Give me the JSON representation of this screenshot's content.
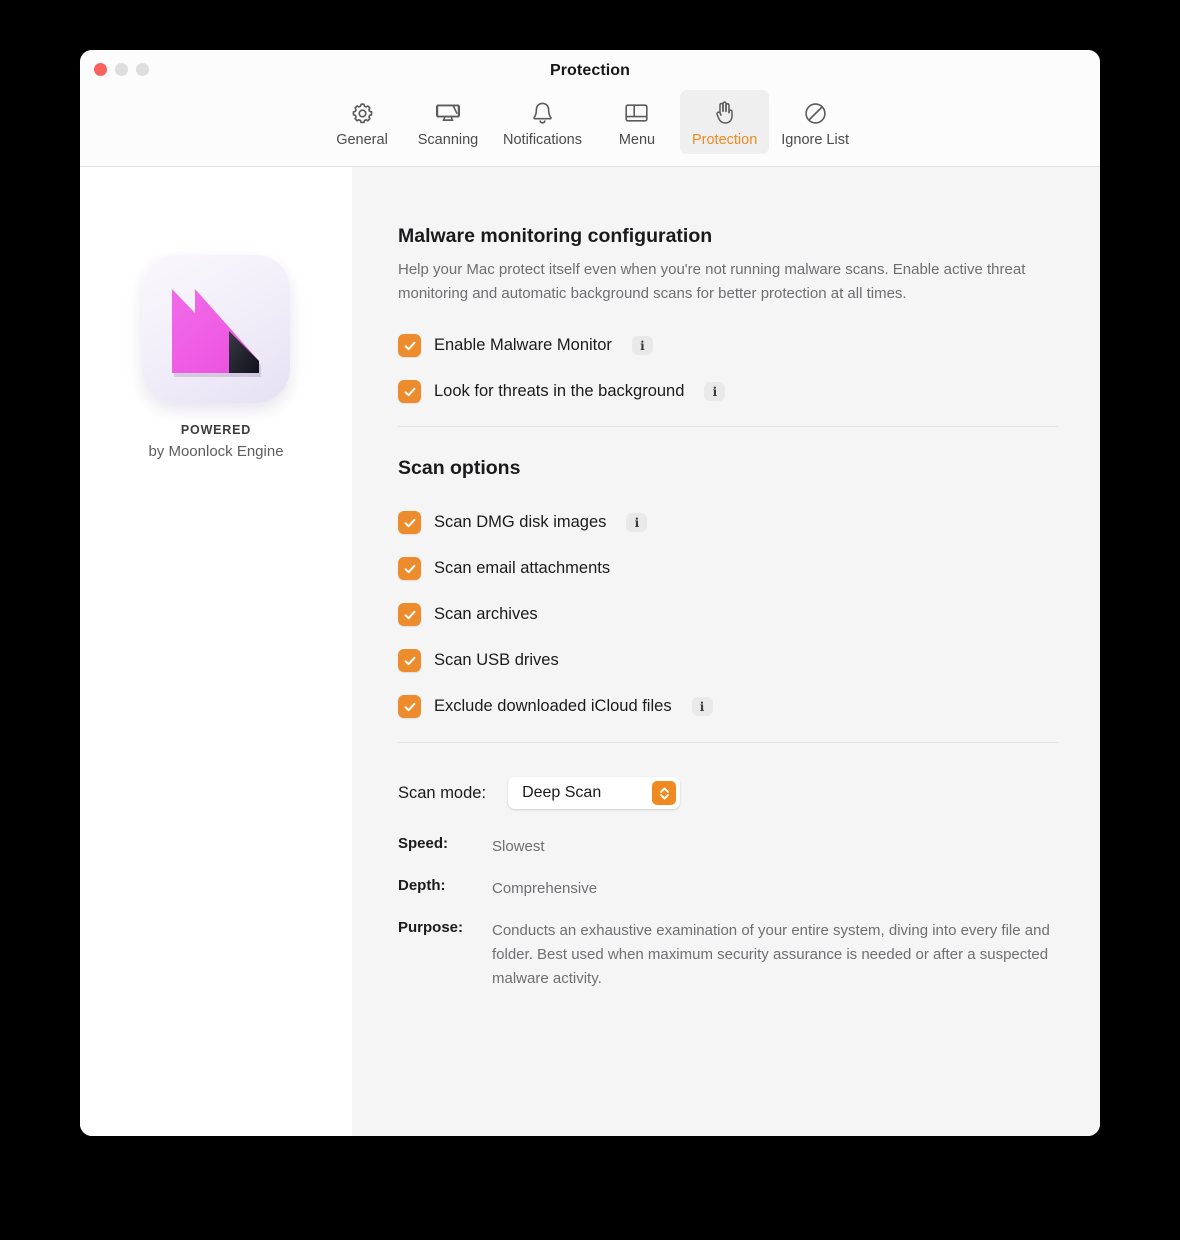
{
  "window": {
    "title": "Protection",
    "traffic_lights": [
      "close-button",
      "minimize-button",
      "zoom-button"
    ]
  },
  "toolbar": {
    "tabs": [
      {
        "label": "General",
        "icon": "gear-icon",
        "selected": false
      },
      {
        "label": "Scanning",
        "icon": "monitor-scan-icon",
        "selected": false
      },
      {
        "label": "Notifications",
        "icon": "bell-icon",
        "selected": false
      },
      {
        "label": "Menu",
        "icon": "sidebar-layout-icon",
        "selected": false
      },
      {
        "label": "Protection",
        "icon": "hand-icon",
        "selected": true
      },
      {
        "label": "Ignore List",
        "icon": "no-entry-icon",
        "selected": false
      }
    ],
    "selected_color": "#ef8a21",
    "selected_bg": "#efefef"
  },
  "sidebar": {
    "logo_icon": "moonlock-logo-icon",
    "powered_label": "POWERED",
    "engine_label": "by Moonlock Engine"
  },
  "main": {
    "monitoring": {
      "title": "Malware monitoring configuration",
      "description": "Help your Mac protect itself even when you're not running malware scans. Enable active threat monitoring and automatic background scans for better protection at all times.",
      "options": [
        {
          "label": "Enable Malware Monitor",
          "checked": true,
          "info": true,
          "info_glyph": "i"
        },
        {
          "label": "Look for threats in the background",
          "checked": true,
          "info": true,
          "info_glyph": "i"
        }
      ]
    },
    "scan_options": {
      "title": "Scan options",
      "options": [
        {
          "label": "Scan DMG disk images",
          "checked": true,
          "info": true,
          "info_glyph": "i"
        },
        {
          "label": "Scan email attachments",
          "checked": true,
          "info": false,
          "info_glyph": "i"
        },
        {
          "label": "Scan archives",
          "checked": true,
          "info": false,
          "info_glyph": "i"
        },
        {
          "label": "Scan USB drives",
          "checked": true,
          "info": false,
          "info_glyph": "i"
        },
        {
          "label": "Exclude downloaded iCloud files",
          "checked": true,
          "info": true,
          "info_glyph": "i"
        }
      ]
    },
    "scan_mode": {
      "label": "Scan mode:",
      "selected": "Deep Scan",
      "details": [
        {
          "key": "Speed:",
          "value": "Slowest"
        },
        {
          "key": "Depth:",
          "value": "Comprehensive"
        },
        {
          "key": "Purpose:",
          "value": "Conducts an exhaustive examination of your entire system, diving into every file and folder. Best used when maximum security assurance is needed or after a suspected malware activity."
        }
      ]
    }
  },
  "colors": {
    "accent": "#ef8a21",
    "checkbox": "#ed8c2c",
    "sidebar_bg": "#ffffff",
    "main_bg": "#f5f5f5",
    "titlebar_bg": "#fcfcfc",
    "close_red": "#f9615c"
  }
}
